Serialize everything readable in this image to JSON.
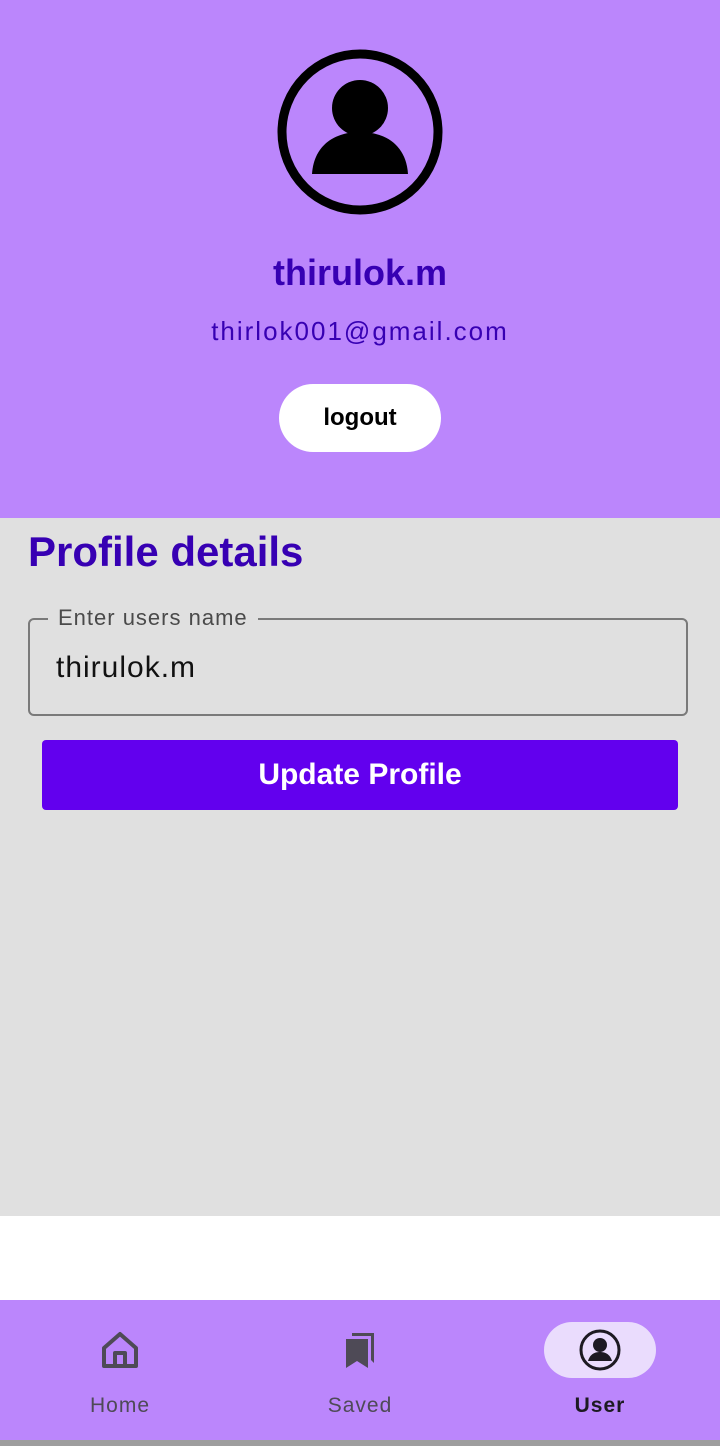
{
  "header": {
    "avatar_icon": "account-circle-icon",
    "user_name": "thirulok.m",
    "email": "thirlok001@gmail.com",
    "logout_label": "logout"
  },
  "profile": {
    "title": "Profile details",
    "name_field": {
      "label": "Enter users name",
      "value": "thirulok.m"
    },
    "update_label": "Update Profile"
  },
  "bottom_nav": {
    "items": [
      {
        "label": "Home",
        "icon": "home-icon",
        "active": false
      },
      {
        "label": "Saved",
        "icon": "bookmarks-icon",
        "active": false
      },
      {
        "label": "User",
        "icon": "account-circle-icon",
        "active": true
      }
    ]
  },
  "colors": {
    "header_bg": "#bb86fc",
    "accent": "#6200ee",
    "title_text": "#3700b3",
    "content_bg": "#e0e0e0"
  }
}
